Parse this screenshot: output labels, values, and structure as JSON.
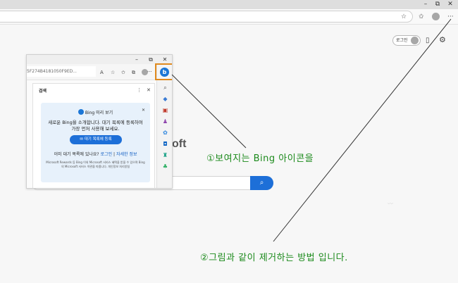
{
  "browser": {
    "window_controls": {
      "minimize": "–",
      "restore": "⧉",
      "close": "✕"
    },
    "more_menu": "···"
  },
  "page": {
    "login_button": "로그인",
    "logo_fragment": "oft"
  },
  "inner": {
    "window_controls": {
      "minimize": "–",
      "restore": "⧉",
      "close": "✕"
    },
    "address_text": "5F274B4181050F9ED...",
    "more_menu": "···",
    "panel": {
      "title": "검색",
      "more": "⋮",
      "close": "✕",
      "card": {
        "title": "Bing 미리 보기",
        "close": "✕",
        "body": "새로운 Bing을 소개합니다. 대기 목록에 등록하여 가장 먼저 사용해 보세요.",
        "add_button": "대기 목록에 등록",
        "question": "이미 대기 목록에 있나요?",
        "login_link": "로그인",
        "separator": "|",
        "details_link": "자세한 정보",
        "fine_print": "Microsoft Rewards 등 Bing 이외 Microsoft 서비스 혜택을 받을 수 있으며 Bing의 Microsoft 서비스 약관을 따릅니다. 개인정보 처리방침"
      }
    },
    "bing_icon": "b"
  },
  "annotations": {
    "first": "①보여지는 Bing 아이콘을",
    "second": "②그림과 같이 제거하는 방법 입니다."
  },
  "colors": {
    "highlight": "#e08a1e",
    "annotation": "#1b8a1b",
    "bing_blue": "#1b76d6",
    "button_blue": "#1d6fd8"
  }
}
